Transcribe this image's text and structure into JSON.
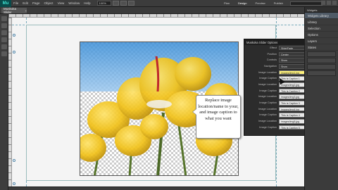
{
  "app": {
    "logo": "Mu",
    "document_tab": "Muskoka Slider"
  },
  "menu": {
    "items": [
      "File",
      "Edit",
      "Page",
      "Object",
      "View",
      "Window",
      "Help"
    ],
    "zoom": "100%"
  },
  "workspace": {
    "items": [
      "Plan",
      "Design",
      "Preview",
      "Publish"
    ],
    "active": "Design"
  },
  "caption": {
    "text": "Replace image location/name to your, and image caption to what you want"
  },
  "inspector": {
    "title": "Muskoka Slider Options",
    "close": "×",
    "rows": [
      {
        "label": "Effect",
        "value": "Slide/Fade",
        "kind": "select"
      },
      {
        "label": "Position",
        "value": "Center",
        "kind": "select"
      },
      {
        "label": "Controls",
        "value": "Show",
        "kind": "select"
      },
      {
        "label": "Navigation",
        "value": "Show",
        "kind": "select"
      },
      {
        "label": "Image Location",
        "value": "images/img1.jpg",
        "kind": "field",
        "highlight": true
      },
      {
        "label": "Image Caption",
        "value": "This is Caption 1",
        "kind": "field"
      },
      {
        "label": "Image Location",
        "value": "images/img2.jpg",
        "kind": "field"
      },
      {
        "label": "Image Caption",
        "value": "This is Caption 2",
        "kind": "field"
      },
      {
        "label": "Image Location",
        "value": "images/img3.jpg",
        "kind": "field"
      },
      {
        "label": "Image Caption",
        "value": "This is Caption 3",
        "kind": "field"
      },
      {
        "label": "Image Location",
        "value": "images/img4.jpg",
        "kind": "field"
      },
      {
        "label": "Image Caption",
        "value": "This is Caption 4",
        "kind": "field"
      },
      {
        "label": "Image Location",
        "value": "images/img5.jpg",
        "kind": "field"
      },
      {
        "label": "Image Caption",
        "value": "This is Caption 5",
        "kind": "field"
      }
    ]
  },
  "right_panel": {
    "header": "Widgets",
    "items": [
      "Widgets Library",
      "Library",
      "Selection",
      "Options",
      "Layers",
      "States"
    ],
    "selected_index": 0
  },
  "colors": {
    "accent": "#3fe0d0",
    "highlight": "#f0e13c",
    "tulip": "#f2c218"
  }
}
